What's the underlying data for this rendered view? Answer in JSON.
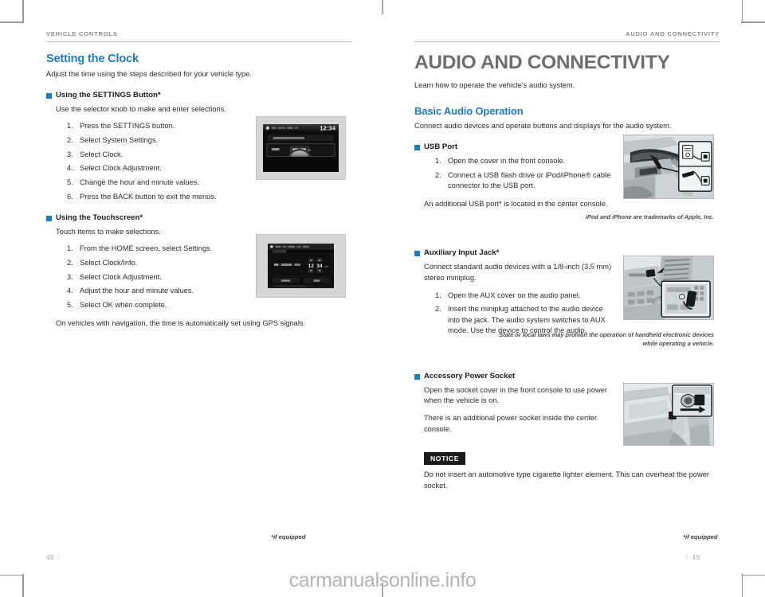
{
  "spread": {
    "left_page": {
      "running_head": "VEHICLE CONTROLS",
      "folio": "48",
      "footnote": "*if equipped",
      "section_title": "Setting the Clock",
      "section_intro": "Adjust the time using the steps described for your vehicle type.",
      "blocks": [
        {
          "heading": "Using the SETTINGS Button*",
          "intro": "Use the selector knob to make and enter selections.",
          "steps": [
            "Press the SETTINGS button.",
            "Select System Settings.",
            "Select Clock.",
            "Select Clock Adjustment.",
            "Change the hour and minute values.",
            "Press the BACK button to exit the menus."
          ],
          "figure": {
            "name": "settings-clock-display",
            "screen_time": "12:34"
          }
        },
        {
          "heading": "Using the Touchscreen*",
          "intro": "Touch items to make selections.",
          "steps": [
            "From the HOME screen, select Settings.",
            "Select Clock/Info.",
            "Select Clock Adjustment.",
            "Adjust the hour and minute values.",
            "Select OK when complete."
          ],
          "figure": {
            "name": "touchscreen-clock-adjustment",
            "hour": "12",
            "minute": "34"
          }
        }
      ],
      "closing_note": "On vehicles with navigation, the time is automatically set using GPS signals."
    },
    "right_page": {
      "running_head": "AUDIO AND CONNECTIVITY",
      "folio": "49",
      "footnote": "*if equipped",
      "chapter_title": "AUDIO AND CONNECTIVITY",
      "chapter_intro": "Learn how to operate the vehicle's audio system.",
      "section_title": "Basic Audio Operation",
      "section_intro": "Connect audio devices and operate buttons and displays for the audio system.",
      "blocks": [
        {
          "heading": "USB Port",
          "steps": [
            "Open the cover in the front console.",
            "Connect a USB flash drive or iPod/iPhone® cable connector to the USB port."
          ],
          "paragraphs": [
            "An additional USB port* is located in the center console."
          ],
          "figure": {
            "name": "usb-port-console-photo"
          },
          "caption": "iPod and iPhone are trademarks of Apple, Inc."
        },
        {
          "heading": "Auxiliary Input Jack*",
          "paragraphs_before": [
            "Connect standard audio devices with a 1/8-inch (3.5 mm) stereo miniplug."
          ],
          "steps": [
            "Open the AUX cover on the audio panel.",
            "Insert the miniplug attached to the audio device into the jack. The audio system switches to AUX mode. Use the device to control the audio."
          ],
          "figure": {
            "name": "aux-input-jack-photo"
          },
          "caption": "State or local laws may prohibit the operation of handheld electronic devices while operating a vehicle."
        },
        {
          "heading": "Accessory Power Socket",
          "paragraphs": [
            "Open the socket cover in the front console to use power when the vehicle is on.",
            "There is an additional power socket inside the center console."
          ],
          "figure": {
            "name": "accessory-power-socket-photo"
          },
          "notice": {
            "label": "NOTICE",
            "text": "Do not insert an automotive type cigarette lighter element. This can overheat the power socket."
          }
        }
      ]
    }
  },
  "watermark": "carmanualsonline.info",
  "colors": {
    "accent_blue": "#1b7cc2",
    "chapter_gray": "#6e6e6e",
    "rule_gray": "#b9b9b9"
  }
}
